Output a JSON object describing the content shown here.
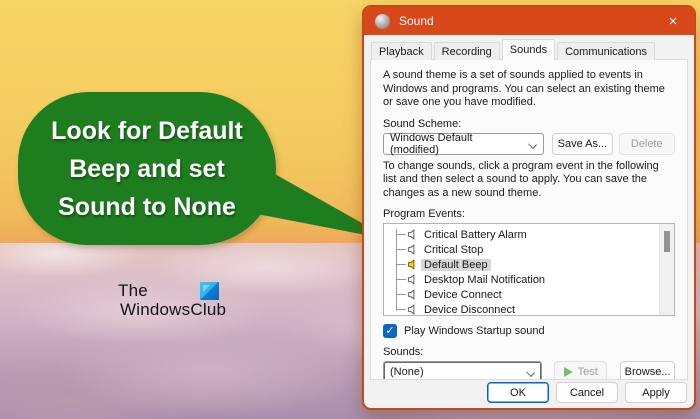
{
  "callout": {
    "lines": [
      "Look for Default",
      "Beep and set",
      "Sound to None"
    ]
  },
  "watermark": {
    "line1": "The",
    "line2": "WindowsClub"
  },
  "dialog": {
    "title": "Sound",
    "close_glyph": "×",
    "tabs": [
      {
        "label": "Playback",
        "active": false
      },
      {
        "label": "Recording",
        "active": false
      },
      {
        "label": "Sounds",
        "active": true
      },
      {
        "label": "Communications",
        "active": false
      }
    ],
    "intro_text": "A sound theme is a set of sounds applied to events in Windows and programs. You can select an existing theme or save one you have modified.",
    "sound_scheme": {
      "label": "Sound Scheme:",
      "value": "Windows Default (modified)",
      "save_as_label": "Save As...",
      "delete_label": "Delete"
    },
    "change_text": "To change sounds, click a program event in the following list and then select a sound to apply. You can save the changes as a new sound theme.",
    "program_events": {
      "label": "Program Events:",
      "items": [
        {
          "label": "Critical Battery Alarm",
          "selected": false
        },
        {
          "label": "Critical Stop",
          "selected": false
        },
        {
          "label": "Default Beep",
          "selected": true
        },
        {
          "label": "Desktop Mail Notification",
          "selected": false
        },
        {
          "label": "Device Connect",
          "selected": false
        },
        {
          "label": "Device Disconnect",
          "selected": false
        }
      ]
    },
    "startup_checkbox": {
      "label": "Play Windows Startup sound",
      "checked": true,
      "check_glyph": "✓"
    },
    "sounds": {
      "label": "Sounds:",
      "value": "(None)",
      "test_label": "Test",
      "browse_label": "Browse..."
    },
    "footer": {
      "ok": "OK",
      "cancel": "Cancel",
      "apply": "Apply"
    }
  },
  "colors": {
    "accent": "#d8481b",
    "bubble_green": "#1e7d1f",
    "checkbox_blue": "#0b67c2",
    "ok_border": "#0067c0",
    "speaker_yellow": "#ffd400"
  }
}
